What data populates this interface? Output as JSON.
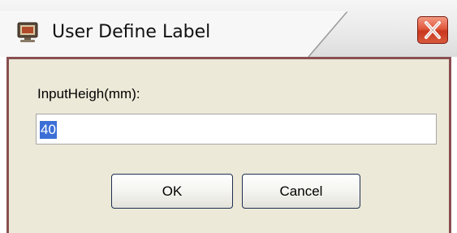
{
  "window": {
    "title": "User Define Label",
    "icon": "app-monitor-icon",
    "close_icon": "close-x-icon"
  },
  "form": {
    "label": "InputHeigh(mm):",
    "value": "40",
    "value_selected": true
  },
  "buttons": {
    "ok_label": "OK",
    "cancel_label": "Cancel"
  },
  "colors": {
    "frame_border": "#8a4f52",
    "client_bg": "#ece9d8",
    "close_button": "#d8472b",
    "selection": "#3b6fd6"
  }
}
